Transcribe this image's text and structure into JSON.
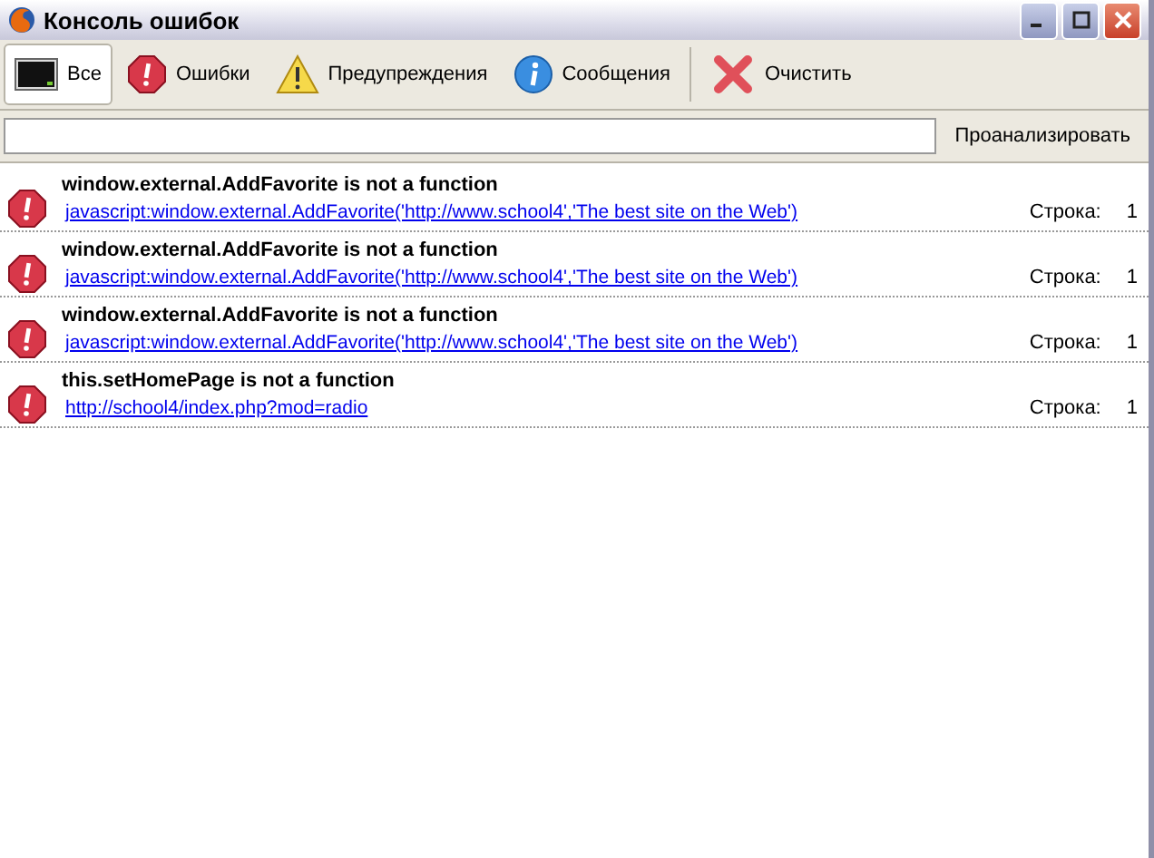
{
  "window": {
    "title": "Консоль ошибок"
  },
  "tabs": [
    {
      "label": "Все",
      "kind": "all",
      "selected": true
    },
    {
      "label": "Ошибки",
      "kind": "error",
      "selected": false
    },
    {
      "label": "Предупреждения",
      "kind": "warning",
      "selected": false
    },
    {
      "label": "Сообщения",
      "kind": "info",
      "selected": false
    }
  ],
  "clear_button": {
    "label": "Очистить"
  },
  "evaluate_button": {
    "label": "Проанализировать"
  },
  "messages": [
    {
      "kind": "error",
      "text": "window.external.AddFavorite is not a function",
      "source": "javascript:window.external.AddFavorite('http://www.school4','The best site on the Web')",
      "line_label": "Строка:",
      "line": "1"
    },
    {
      "kind": "error",
      "text": "window.external.AddFavorite is not a function",
      "source": "javascript:window.external.AddFavorite('http://www.school4','The best site on the Web')",
      "line_label": "Строка:",
      "line": "1"
    },
    {
      "kind": "error",
      "text": "window.external.AddFavorite is not a function",
      "source": "javascript:window.external.AddFavorite('http://www.school4','The best site on the Web')",
      "line_label": "Строка:",
      "line": "1"
    },
    {
      "kind": "error",
      "text": "this.setHomePage is not a function",
      "source": "http://school4/index.php?mod=radio",
      "line_label": "Строка:",
      "line": "1"
    }
  ]
}
